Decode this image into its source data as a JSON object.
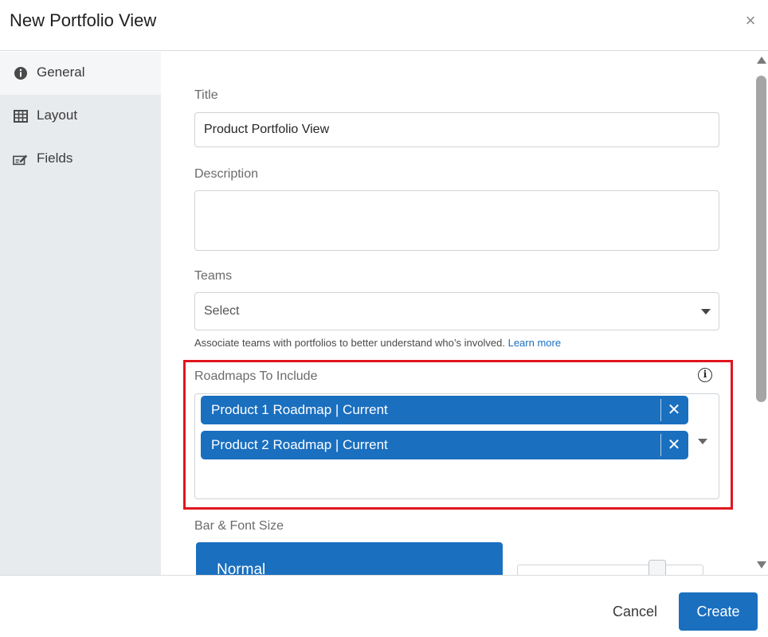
{
  "dialog": {
    "title": "New Portfolio View",
    "close_icon": "×"
  },
  "sidebar": {
    "items": [
      {
        "label": "General",
        "icon": "info-circle-icon",
        "active": true
      },
      {
        "label": "Layout",
        "icon": "grid-icon",
        "active": false
      },
      {
        "label": "Fields",
        "icon": "edit-fields-icon",
        "active": false
      }
    ]
  },
  "form": {
    "title": {
      "label": "Title",
      "value": "Product Portfolio View"
    },
    "description": {
      "label": "Description",
      "value": ""
    },
    "teams": {
      "label": "Teams",
      "value": "Select",
      "helper": "Associate teams with portfolios to better understand who’s involved.",
      "helper_link": "Learn more"
    },
    "roadmaps": {
      "label": "Roadmaps To Include",
      "info_icon": "i",
      "chips": [
        {
          "label": "Product 1 Roadmap | Current",
          "remove": "✕"
        },
        {
          "label": "Product 2 Roadmap | Current",
          "remove": "✕"
        }
      ]
    },
    "bar_font_size": {
      "label": "Bar & Font Size",
      "selected": "Normal"
    }
  },
  "footer": {
    "cancel_label": "Cancel",
    "create_label": "Create"
  },
  "colors": {
    "accent": "#1a6fbf",
    "highlight": "#e0161e",
    "sidebar_bg": "#e8ebee"
  }
}
